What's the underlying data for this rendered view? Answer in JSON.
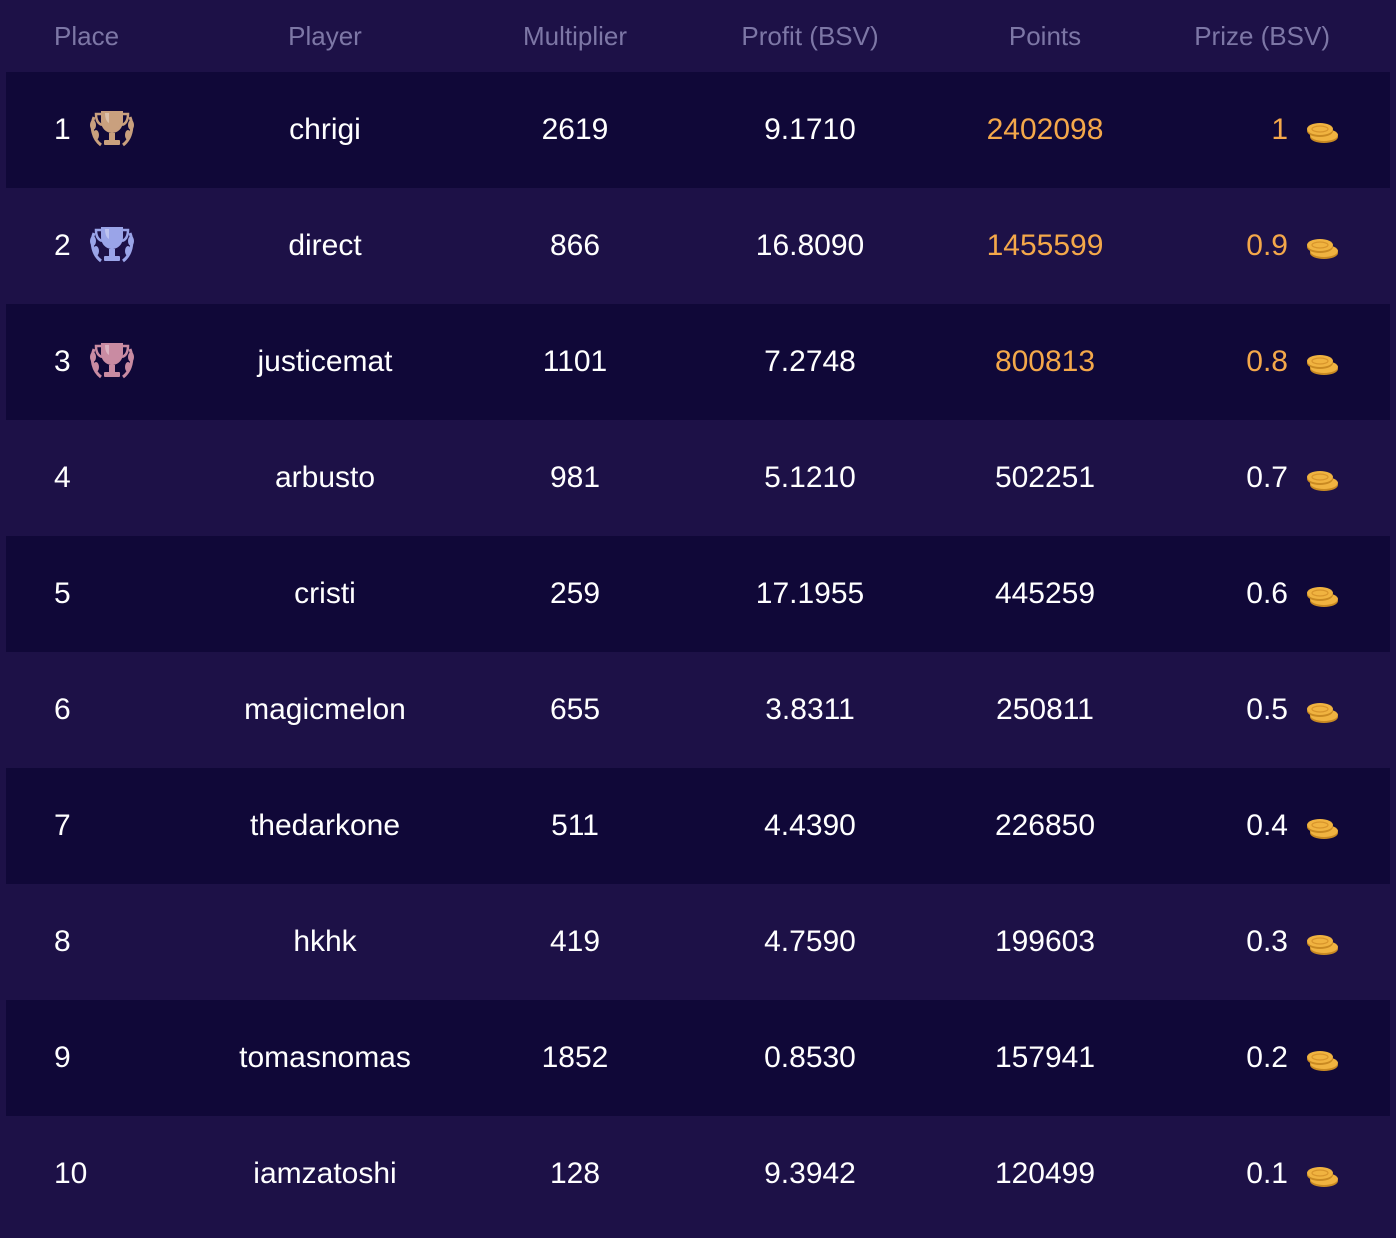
{
  "header": {
    "place": "Place",
    "player": "Player",
    "multiplier": "Multiplier",
    "profit": "Profit (BSV)",
    "points": "Points",
    "prize": "Prize (BSV)"
  },
  "colors": {
    "background": "#1d1147",
    "row_dark": "#100838",
    "header_text": "#7d77a6",
    "highlight": "#f4a84a",
    "trophy_gold": "#c9a07e",
    "trophy_silver": "#9aa4e8",
    "trophy_bronze": "#c98ba2",
    "coin": "#f0b340"
  },
  "rows": [
    {
      "place": "1",
      "player": "chrigi",
      "multiplier": "2619",
      "profit": "9.1710",
      "points": "2402098",
      "prize": "1",
      "trophy": "gold-trophy-icon",
      "highlight": true
    },
    {
      "place": "2",
      "player": "direct",
      "multiplier": "866",
      "profit": "16.8090",
      "points": "1455599",
      "prize": "0.9",
      "trophy": "silver-trophy-icon",
      "highlight": true
    },
    {
      "place": "3",
      "player": "justicemat",
      "multiplier": "1101",
      "profit": "7.2748",
      "points": "800813",
      "prize": "0.8",
      "trophy": "bronze-trophy-icon",
      "highlight": true
    },
    {
      "place": "4",
      "player": "arbusto",
      "multiplier": "981",
      "profit": "5.1210",
      "points": "502251",
      "prize": "0.7"
    },
    {
      "place": "5",
      "player": "cristi",
      "multiplier": "259",
      "profit": "17.1955",
      "points": "445259",
      "prize": "0.6"
    },
    {
      "place": "6",
      "player": "magicmelon",
      "multiplier": "655",
      "profit": "3.8311",
      "points": "250811",
      "prize": "0.5"
    },
    {
      "place": "7",
      "player": "thedarkone",
      "multiplier": "511",
      "profit": "4.4390",
      "points": "226850",
      "prize": "0.4"
    },
    {
      "place": "8",
      "player": "hkhk",
      "multiplier": "419",
      "profit": "4.7590",
      "points": "199603",
      "prize": "0.3"
    },
    {
      "place": "9",
      "player": "tomasnomas",
      "multiplier": "1852",
      "profit": "0.8530",
      "points": "157941",
      "prize": "0.2"
    },
    {
      "place": "10",
      "player": "iamzatoshi",
      "multiplier": "128",
      "profit": "9.3942",
      "points": "120499",
      "prize": "0.1"
    }
  ]
}
